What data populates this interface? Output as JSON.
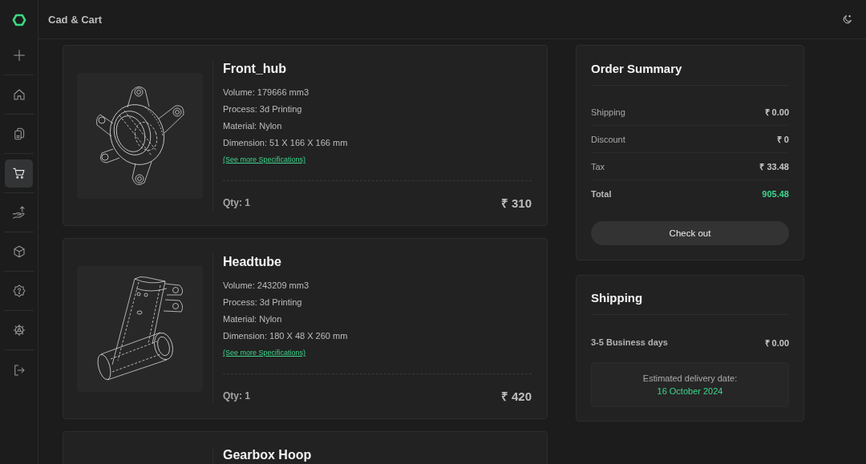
{
  "header": {
    "title": "Cad & Cart"
  },
  "sidebar": {
    "items": [
      {
        "kind": "add",
        "selected": false
      },
      {
        "kind": "home",
        "selected": false
      },
      {
        "kind": "documents",
        "selected": false
      },
      {
        "kind": "cart",
        "selected": true
      },
      {
        "kind": "upload",
        "selected": false
      },
      {
        "kind": "cube",
        "selected": false
      },
      {
        "kind": "help",
        "selected": false
      },
      {
        "kind": "settings",
        "selected": false
      },
      {
        "kind": "logout",
        "selected": false
      }
    ]
  },
  "products": [
    {
      "title": "Front_hub",
      "kind": "hub",
      "specs": [
        "Volume: 179666 mm3",
        "Process: 3d Printing",
        "Material: Nylon",
        "Dimension: 51 X 166 X 166 mm"
      ],
      "link": "(See more Specifications)",
      "qty": "Qty: 1",
      "price": "₹ 310"
    },
    {
      "title": "Headtube",
      "kind": "tube",
      "specs": [
        "Volume: 243209 mm3",
        "Process: 3d Printing",
        "Material: Nylon",
        "Dimension: 180 X 48 X 260 mm"
      ],
      "link": "(See more Specifications)",
      "qty": "Qty: 1",
      "price": "₹ 420"
    },
    {
      "title": "Gearbox Hoop"
    }
  ],
  "order_summary": {
    "title": "Order Summary",
    "rows": [
      {
        "kind": "line",
        "label": "Shipping",
        "value": "₹ 0.00"
      },
      {
        "kind": "line",
        "label": "Discount",
        "value": "₹ 0"
      },
      {
        "kind": "line",
        "label": "Tax",
        "value": "₹ 33.48"
      },
      {
        "kind": "total",
        "label": "Total",
        "value": "905.48"
      }
    ],
    "button": "Check out"
  },
  "shipping": {
    "title": "Shipping",
    "option": {
      "label": "3-5 Business days",
      "value": "₹ 0.00"
    },
    "delivery": {
      "label": "Estimated delivery date:",
      "date": "16 October 2024"
    }
  }
}
